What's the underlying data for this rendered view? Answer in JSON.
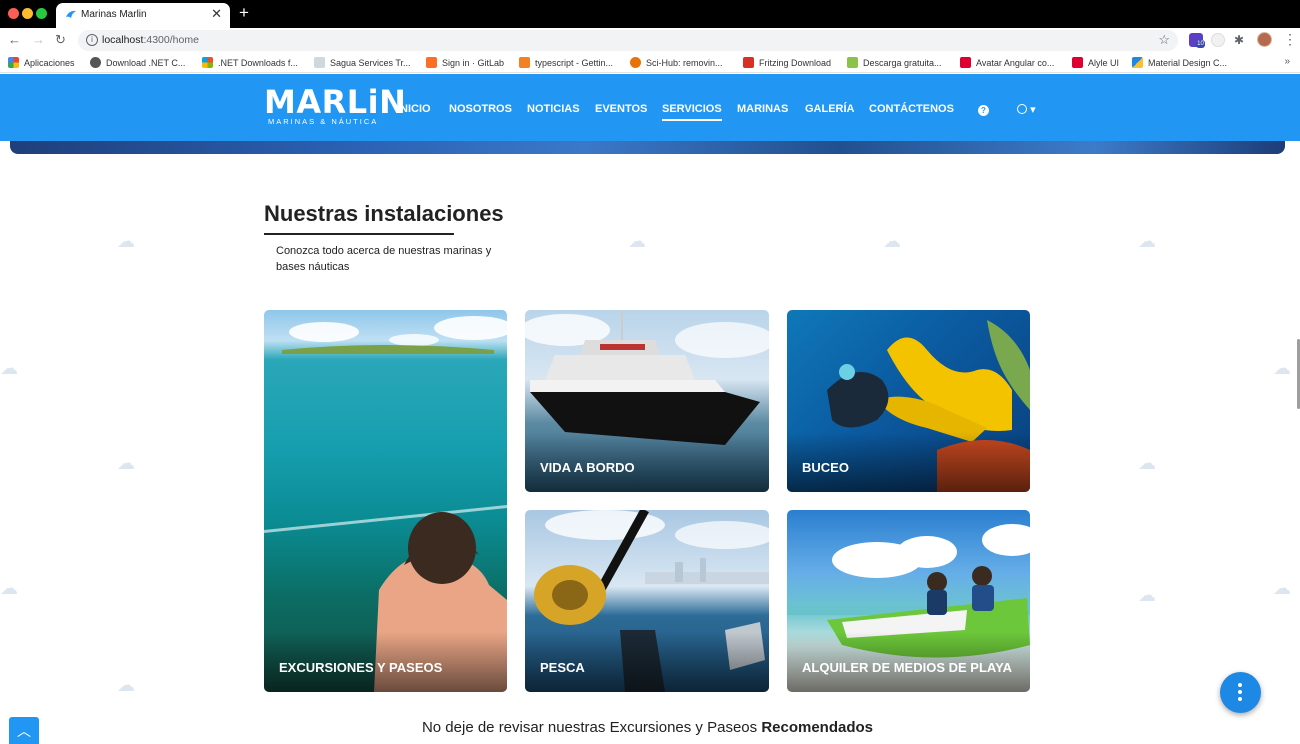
{
  "browser": {
    "tab_title": "Marinas Marlin",
    "tab_close": "✕",
    "new_tab": "+",
    "url_host": "localhost",
    "url_rest": ":4300/home",
    "extension_badge": "10",
    "bookmarks": [
      {
        "label": "Aplicaciones",
        "color": "#ea4335"
      },
      {
        "label": "Download .NET C...",
        "color": "#555555"
      },
      {
        "label": ".NET Downloads f...",
        "color": "#7fba00"
      },
      {
        "label": "Sagua Services Tr...",
        "color": "#9aa0a6"
      },
      {
        "label": "Sign in · GitLab",
        "color": "#fc6d26"
      },
      {
        "label": "typescript - Gettin...",
        "color": "#f48024"
      },
      {
        "label": "Sci-Hub: removin...",
        "color": "#e8710a"
      },
      {
        "label": "Fritzing Download",
        "color": "#d93025"
      },
      {
        "label": "Descarga gratuita...",
        "color": "#8bc34a"
      },
      {
        "label": "Avatar Angular co...",
        "color": "#dd0031"
      },
      {
        "label": "Alyle UI",
        "color": "#dd0031"
      },
      {
        "label": "Material Design C...",
        "color": "#1e88e5"
      }
    ]
  },
  "site": {
    "logo": {
      "word": "MARLiN",
      "tagline": "MARINAS & NÁUTICA"
    },
    "menu": [
      "INICIO",
      "NOSOTROS",
      "NOTICIAS",
      "EVENTOS",
      "SERVICIOS",
      "MARINAS",
      "GALERÍA",
      "CONTÁCTENOS"
    ],
    "active_menu": "SERVICIOS",
    "help_icon": "?",
    "lang_caret": "▾",
    "section": {
      "title": "Nuestras instalaciones",
      "subtitle": "Conozca todo acerca de nuestras marinas y bases náuticas"
    },
    "cards": [
      {
        "label": "EXCURSIONES Y PASEOS"
      },
      {
        "label": "VIDA A BORDO"
      },
      {
        "label": "BUCEO"
      },
      {
        "label": "PESCA"
      },
      {
        "label": "ALQUILER DE MEDIOS DE PLAYA"
      }
    ],
    "bottom": {
      "text": "No deje de revisar nuestras Excursiones y Paseos ",
      "strong": "Recomendados"
    },
    "brand_color": "#2196f3"
  }
}
